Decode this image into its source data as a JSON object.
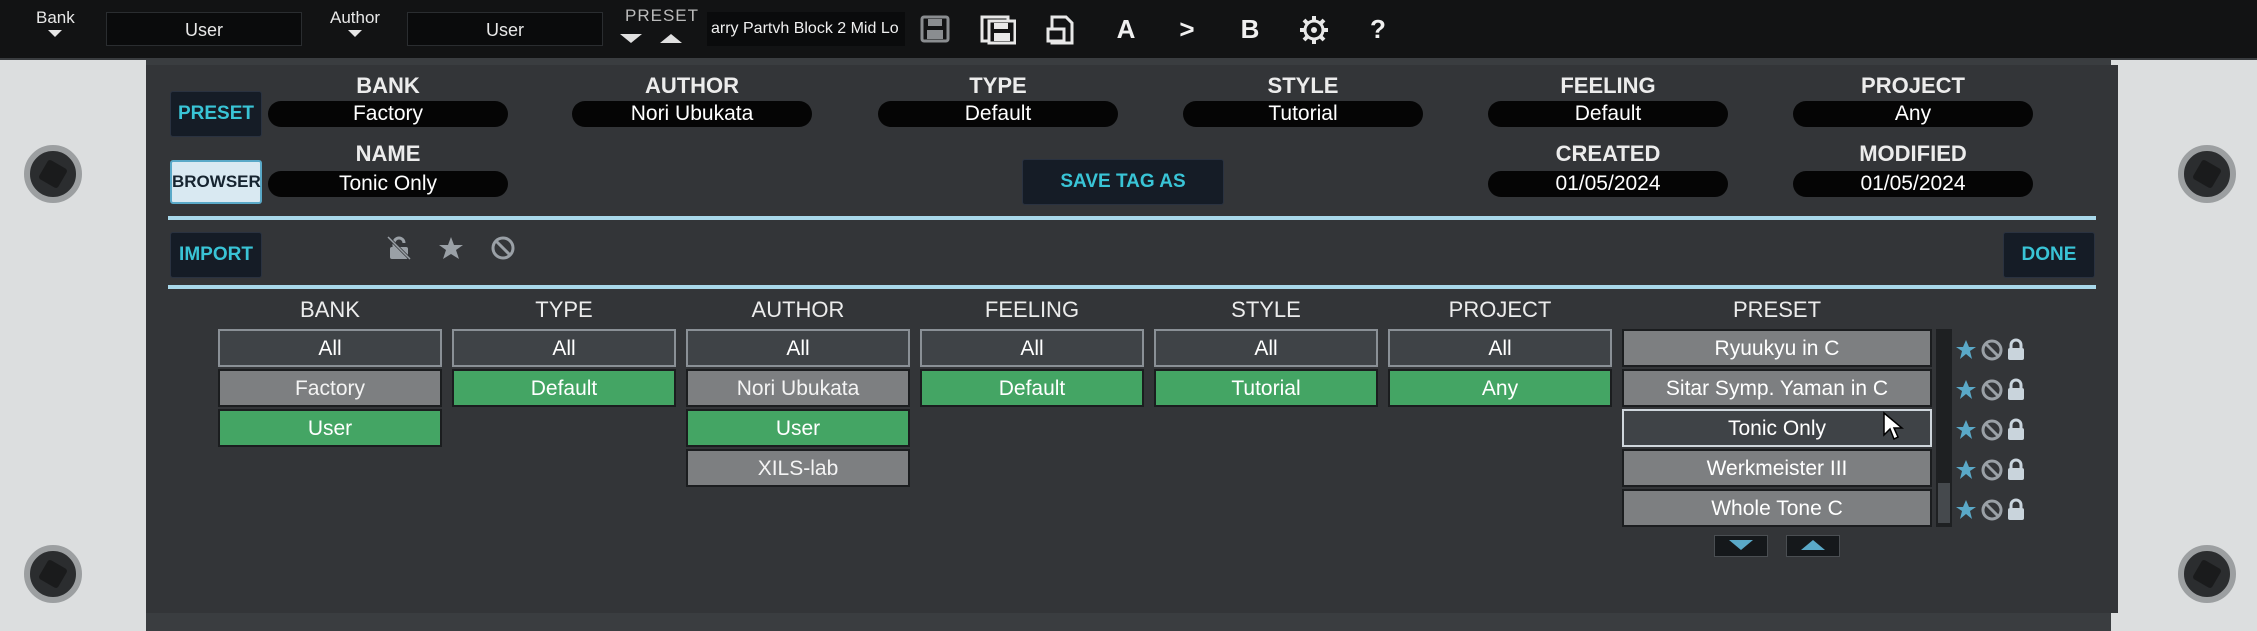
{
  "toolbar": {
    "bank_label": "Bank",
    "bank_value": "User",
    "author_label": "Author",
    "author_value": "User",
    "preset_label": "PRESET",
    "preset_name": "arry Partvh Block 2 Mid Lo",
    "btn_a": "A",
    "btn_compare": ">",
    "btn_b": "B",
    "btn_help": "?"
  },
  "tags": {
    "bank_label": "BANK",
    "bank_value": "Factory",
    "author_label": "AUTHOR",
    "author_value": "Nori Ubukata",
    "type_label": "TYPE",
    "type_value": "Default",
    "style_label": "STYLE",
    "style_value": "Tutorial",
    "feeling_label": "FEELING",
    "feeling_value": "Default",
    "project_label": "PROJECT",
    "project_value": "Any",
    "name_label": "NAME",
    "name_value": "Tonic Only",
    "created_label": "CREATED",
    "created_value": "01/05/2024",
    "modified_label": "MODIFIED",
    "modified_value": "01/05/2024"
  },
  "buttons": {
    "preset": "PRESET",
    "browser": "BROWSER",
    "save_tag_as": "SAVE TAG AS",
    "import": "IMPORT",
    "done": "DONE"
  },
  "columns": {
    "bank": {
      "title": "BANK",
      "items": [
        "All",
        "Factory",
        "User"
      ]
    },
    "type": {
      "title": "TYPE",
      "items": [
        "All",
        "Default"
      ]
    },
    "author": {
      "title": "AUTHOR",
      "items": [
        "All",
        "Nori Ubukata",
        "User",
        "XILS-lab"
      ]
    },
    "feeling": {
      "title": "FEELING",
      "items": [
        "All",
        "Default"
      ]
    },
    "style": {
      "title": "STYLE",
      "items": [
        "All",
        "Tutorial"
      ]
    },
    "project": {
      "title": "PROJECT",
      "items": [
        "All",
        "Any"
      ]
    },
    "preset": {
      "title": "PRESET",
      "items": [
        "Ryuukyu in  C",
        "Sitar Symp. Yaman in C",
        "Tonic Only",
        "Werkmeister III",
        "Whole Tone C"
      ]
    }
  },
  "colors": {
    "accent": "#39c4d6",
    "selected_green": "#44a564",
    "divider": "#a8d8ea"
  }
}
